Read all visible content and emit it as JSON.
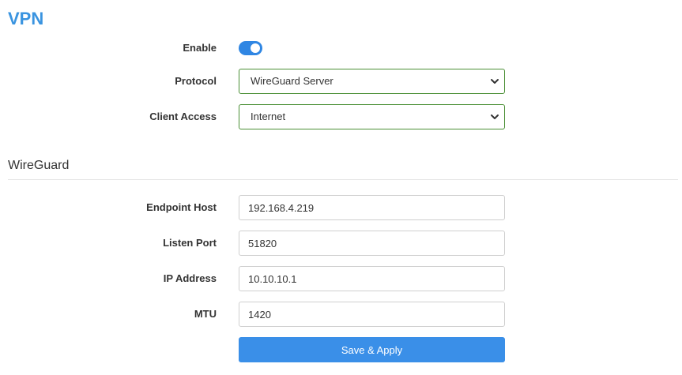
{
  "page": {
    "title": "VPN"
  },
  "vpn": {
    "enable": {
      "label": "Enable",
      "checked": true
    },
    "protocol": {
      "label": "Protocol",
      "value": "WireGuard Server"
    },
    "client_access": {
      "label": "Client Access",
      "value": "Internet"
    }
  },
  "wireguard": {
    "title": "WireGuard",
    "endpoint_host": {
      "label": "Endpoint Host",
      "value": "192.168.4.219"
    },
    "listen_port": {
      "label": "Listen Port",
      "value": "51820"
    },
    "ip_address": {
      "label": "IP Address",
      "value": "10.10.10.1"
    },
    "mtu": {
      "label": "MTU",
      "value": "1420"
    }
  },
  "actions": {
    "apply_label": "Save & Apply"
  },
  "colors": {
    "accent": "#3a94e0",
    "toggle_on": "#2f86e3",
    "select_border": "#4a8f35",
    "button": "#3a8fe8"
  },
  "icons": {
    "select_arrow": "chevron-down-icon"
  }
}
